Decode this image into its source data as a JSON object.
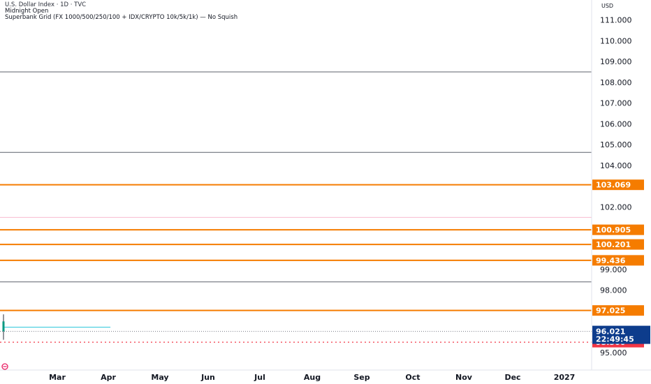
{
  "legend": {
    "symbol_line": "U.S. Dollar Index · 1D · TVC",
    "indicator_1": "Midnight Open",
    "indicator_2": "Superbank Grid (FX 1000/500/250/100 + IDX/CRYPTO 10k/5k/1k) — No Squish"
  },
  "price_axis": {
    "currency": "USD",
    "ticks": [
      "111.000",
      "110.000",
      "109.000",
      "108.000",
      "107.000",
      "106.000",
      "105.000",
      "104.000",
      "102.000",
      "99.000",
      "98.000",
      "95.000"
    ]
  },
  "time_axis": {
    "labels": [
      "Mar",
      "Apr",
      "May",
      "Jun",
      "Jul",
      "Aug",
      "Sep",
      "Oct",
      "Nov",
      "Dec",
      "2027"
    ]
  },
  "colors": {
    "orange": "#f57c00",
    "grey_line": "#5d606b",
    "pink_line": "#f8bbd0",
    "cyan_line": "#4dd0e1",
    "red_dotted": "#f23645",
    "last_price_bg": "#0d3c8c",
    "candle": "#089981"
  },
  "chart_data": {
    "type": "line",
    "title": "U.S. Dollar Index · 1D · TVC",
    "ylabel": "USD",
    "ylim": [
      94.5,
      111.5
    ],
    "x_range": [
      "2026-02-01",
      "2027-01-20"
    ],
    "series": [
      {
        "name": "U.S. Dollar Index",
        "x": [
          "2026-02-01",
          "2026-02-02"
        ],
        "y": [
          96.5,
          96.021
        ]
      }
    ],
    "horizontal_levels": [
      {
        "value": 108.5,
        "style": "grey"
      },
      {
        "value": 104.63,
        "style": "grey"
      },
      {
        "value": 103.069,
        "style": "orange",
        "tag": "103.069"
      },
      {
        "value": 101.5,
        "style": "pink"
      },
      {
        "value": 100.905,
        "style": "orange",
        "tag": "100.905"
      },
      {
        "value": 100.201,
        "style": "orange",
        "tag": "100.201"
      },
      {
        "value": 99.436,
        "style": "orange",
        "tag": "99.436"
      },
      {
        "value": 98.4,
        "style": "grey"
      },
      {
        "value": 97.025,
        "style": "orange",
        "tag": "97.025"
      },
      {
        "value": 95.5,
        "style": "red-dotted",
        "tag": "95.500"
      }
    ],
    "midnight_open": {
      "value": 96.22,
      "x_end": "2026-04-08"
    },
    "last_price": {
      "value": "96.021",
      "countdown": "22:49:45"
    }
  }
}
